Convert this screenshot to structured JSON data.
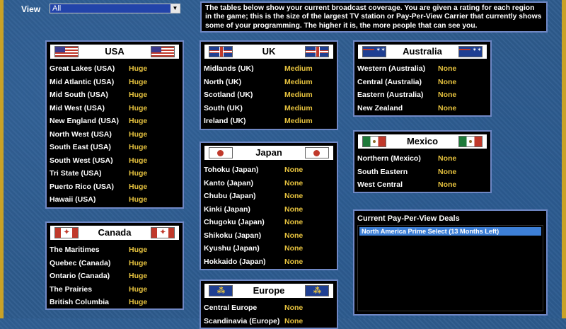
{
  "view": {
    "label": "View",
    "selected": "All"
  },
  "info": {
    "text": "The tables below show your current broadcast coverage. You are given a rating for each region in the game; this is the size of the largest TV station or Pay-Per-View Carrier that currently shows some of your programming. The higher it is, the more people that can see you."
  },
  "colors": {
    "panel_border": "#6f87c4",
    "rating_text": "#e6c23e",
    "background": "#2e5c8e",
    "highlight": "#3d7fd6"
  },
  "regions": {
    "usa": {
      "title": "USA",
      "flag_icon": "usa-flag-icon",
      "rows": [
        {
          "name": "Great Lakes (USA)",
          "rating": "Huge"
        },
        {
          "name": "Mid Atlantic (USA)",
          "rating": "Huge"
        },
        {
          "name": "Mid South (USA)",
          "rating": "Huge"
        },
        {
          "name": "Mid West (USA)",
          "rating": "Huge"
        },
        {
          "name": "New England (USA)",
          "rating": "Huge"
        },
        {
          "name": "North West (USA)",
          "rating": "Huge"
        },
        {
          "name": "South East (USA)",
          "rating": "Huge"
        },
        {
          "name": "South West (USA)",
          "rating": "Huge"
        },
        {
          "name": "Tri State (USA)",
          "rating": "Huge"
        },
        {
          "name": "Puerto Rico (USA)",
          "rating": "Huge"
        },
        {
          "name": "Hawaii (USA)",
          "rating": "Huge"
        }
      ]
    },
    "canada": {
      "title": "Canada",
      "flag_icon": "canada-flag-icon",
      "rows": [
        {
          "name": "The Maritimes",
          "rating": "Huge"
        },
        {
          "name": "Quebec (Canada)",
          "rating": "Huge"
        },
        {
          "name": "Ontario (Canada)",
          "rating": "Huge"
        },
        {
          "name": "The Prairies",
          "rating": "Huge"
        },
        {
          "name": "British Columbia",
          "rating": "Huge"
        }
      ]
    },
    "uk": {
      "title": "UK",
      "flag_icon": "uk-flag-icon",
      "rows": [
        {
          "name": "Midlands (UK)",
          "rating": "Medium"
        },
        {
          "name": "North (UK)",
          "rating": "Medium"
        },
        {
          "name": "Scotland (UK)",
          "rating": "Medium"
        },
        {
          "name": "South (UK)",
          "rating": "Medium"
        },
        {
          "name": "Ireland (UK)",
          "rating": "Medium"
        }
      ]
    },
    "japan": {
      "title": "Japan",
      "flag_icon": "japan-flag-icon",
      "rows": [
        {
          "name": "Tohoku (Japan)",
          "rating": "None"
        },
        {
          "name": "Kanto (Japan)",
          "rating": "None"
        },
        {
          "name": "Chubu (Japan)",
          "rating": "None"
        },
        {
          "name": "Kinki (Japan)",
          "rating": "None"
        },
        {
          "name": "Chugoku (Japan)",
          "rating": "None"
        },
        {
          "name": "Shikoku (Japan)",
          "rating": "None"
        },
        {
          "name": "Kyushu (Japan)",
          "rating": "None"
        },
        {
          "name": "Hokkaido (Japan)",
          "rating": "None"
        }
      ]
    },
    "europe": {
      "title": "Europe",
      "flag_icon": "eu-flag-icon",
      "rows": [
        {
          "name": "Central Europe",
          "rating": "None"
        },
        {
          "name": "Scandinavia (Europe)",
          "rating": "None"
        }
      ]
    },
    "australia": {
      "title": "Australia",
      "flag_icon": "australia-flag-icon",
      "rows": [
        {
          "name": "Western (Australia)",
          "rating": "None"
        },
        {
          "name": "Central (Australia)",
          "rating": "None"
        },
        {
          "name": "Eastern (Australia)",
          "rating": "None"
        },
        {
          "name": "New Zealand",
          "rating": "None"
        }
      ]
    },
    "mexico": {
      "title": "Mexico",
      "flag_icon": "mexico-flag-icon",
      "rows": [
        {
          "name": "Northern (Mexico)",
          "rating": "None"
        },
        {
          "name": "South Eastern",
          "rating": "None"
        },
        {
          "name": "West Central",
          "rating": "None"
        }
      ]
    }
  },
  "ppv": {
    "title": "Current Pay-Per-View Deals",
    "items": [
      "North America Prime Select (13 Months Left)"
    ]
  }
}
